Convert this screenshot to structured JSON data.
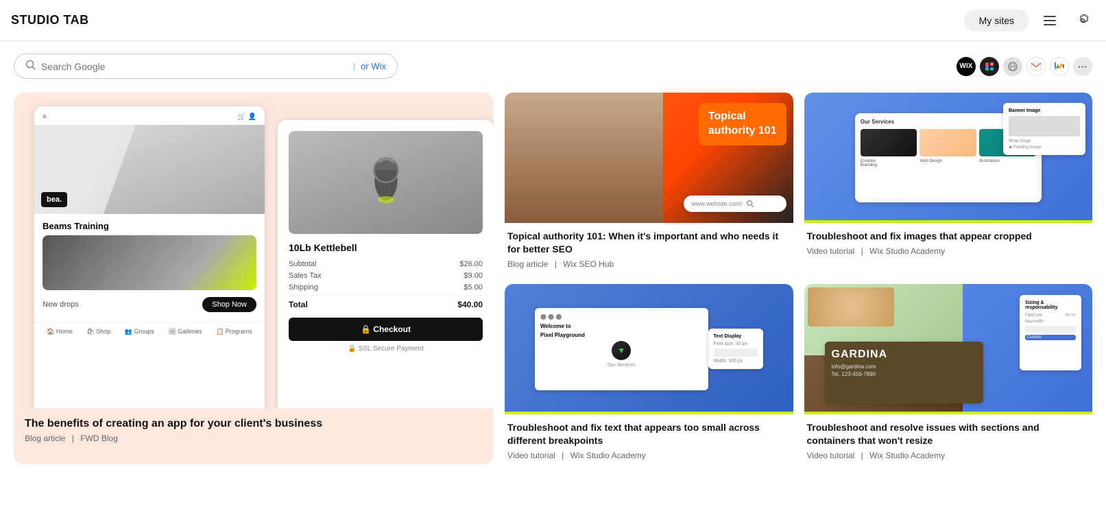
{
  "header": {
    "logo": "STUDIO TAB",
    "my_sites_label": "My sites",
    "icon_menu": "☰",
    "icon_settings": "⚙"
  },
  "search": {
    "placeholder": "Search Google",
    "or_wix_label": "or Wix"
  },
  "extension_icons": [
    {
      "id": "wix",
      "label": "WIX"
    },
    {
      "id": "figma",
      "label": "F"
    },
    {
      "id": "sphere",
      "label": "🌐"
    },
    {
      "id": "gmail",
      "label": "M"
    },
    {
      "id": "analytics",
      "label": "📊"
    },
    {
      "id": "more",
      "label": "···"
    }
  ],
  "cards": {
    "big": {
      "title": "The benefits of creating an app for your client's business",
      "type": "Blog article",
      "source": "FWD Blog",
      "phone_brand": "bea.",
      "phone_title": "Beams Training",
      "phone_cta_label": "New drops",
      "phone_cta_btn": "Shop Now",
      "cart_title": "10Lb Kettlebell",
      "cart_subtotal_label": "Subtotal",
      "cart_subtotal_val": "$26.00",
      "cart_tax_label": "Sales Tax",
      "cart_tax_val": "$9.00",
      "cart_shipping_label": "Shipping",
      "cart_shipping_val": "$5.00",
      "cart_total_label": "Total",
      "cart_total_val": "$40.00",
      "cart_checkout": "🔒 Checkout",
      "cart_ssl": "🔒 SSL Secure Payment"
    },
    "top_right_1": {
      "thumb_type": "topical",
      "orange_line1": "Topical",
      "orange_line2": "authority 101",
      "search_mini": "www.website.com/",
      "title": "Topical authority 101: When it's important and who needs it for better SEO",
      "type": "Blog article",
      "source": "Wix SEO Hub"
    },
    "top_right_2": {
      "thumb_type": "blue_services",
      "ui_header": "Our Services",
      "title": "Troubleshoot and fix images that appear cropped",
      "type": "Video tutorial",
      "source": "Wix Studio Academy"
    },
    "bottom_right_1": {
      "thumb_type": "pixel_playground",
      "title": "Troubleshoot and fix text that appears too small across different breakpoints",
      "type": "Video tutorial",
      "source": "Wix Studio Academy",
      "pixel_welcome": "Welcome to Pixel Playground",
      "pixel_services": "Our Services"
    },
    "bottom_right_2": {
      "thumb_type": "gardina",
      "title": "Troubleshoot and resolve issues with sections and containers that won't resize",
      "type": "Video tutorial",
      "source": "Wix Studio Academy",
      "gardina_name": "GARDINA",
      "gardina_email": "info@gardina.com",
      "gardina_phone": "Tel. 123-456-7890"
    }
  },
  "meta_separator": "|"
}
